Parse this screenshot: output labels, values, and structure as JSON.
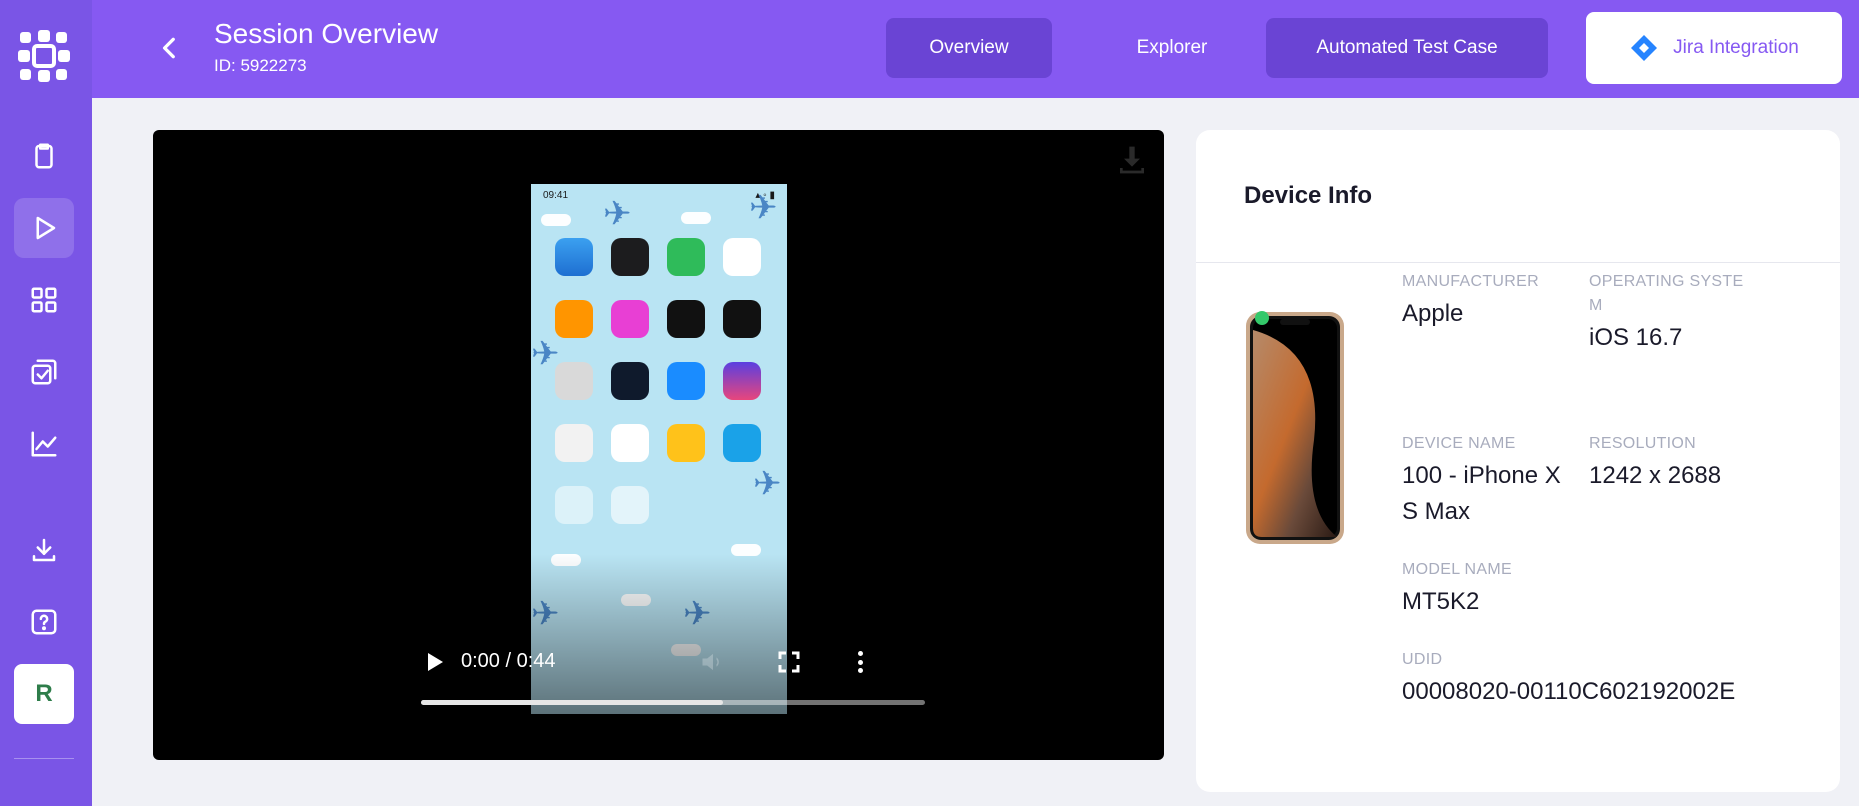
{
  "header": {
    "title": "Session Overview",
    "subtitle": "ID: 5922273",
    "nav": {
      "overview": "Overview",
      "explorer": "Explorer",
      "automated": "Automated Test Case",
      "jira": "Jira Integration"
    }
  },
  "sidebar": {
    "avatar_initial": "R",
    "items": [
      "clipboard-icon",
      "play-icon",
      "grid-icon",
      "checklist-icon",
      "chart-icon",
      "download-icon",
      "help-icon"
    ]
  },
  "video": {
    "time": "0:00 / 0:44",
    "progress": 0.6,
    "status_time": "09:41"
  },
  "device_info": {
    "title": "Device Info",
    "manufacturer_label": "MANUFACTURER",
    "manufacturer_value": "Apple",
    "os_label": "OPERATING SYSTEM",
    "os_value": "iOS 16.7",
    "device_name_label": "DEVICE NAME",
    "device_name_value": "100 - iPhone XS Max",
    "resolution_label": "RESOLUTION",
    "resolution_value": "1242 x 2688",
    "model_label": "MODEL NAME",
    "model_value": "MT5K2",
    "udid_label": "UDID",
    "udid_value": "00008020-00110C602192002E"
  },
  "colors": {
    "sidebar": "#7a55e6",
    "header": "#8659f2",
    "accent": "#8659f2",
    "jira_blue": "#2684ff"
  }
}
